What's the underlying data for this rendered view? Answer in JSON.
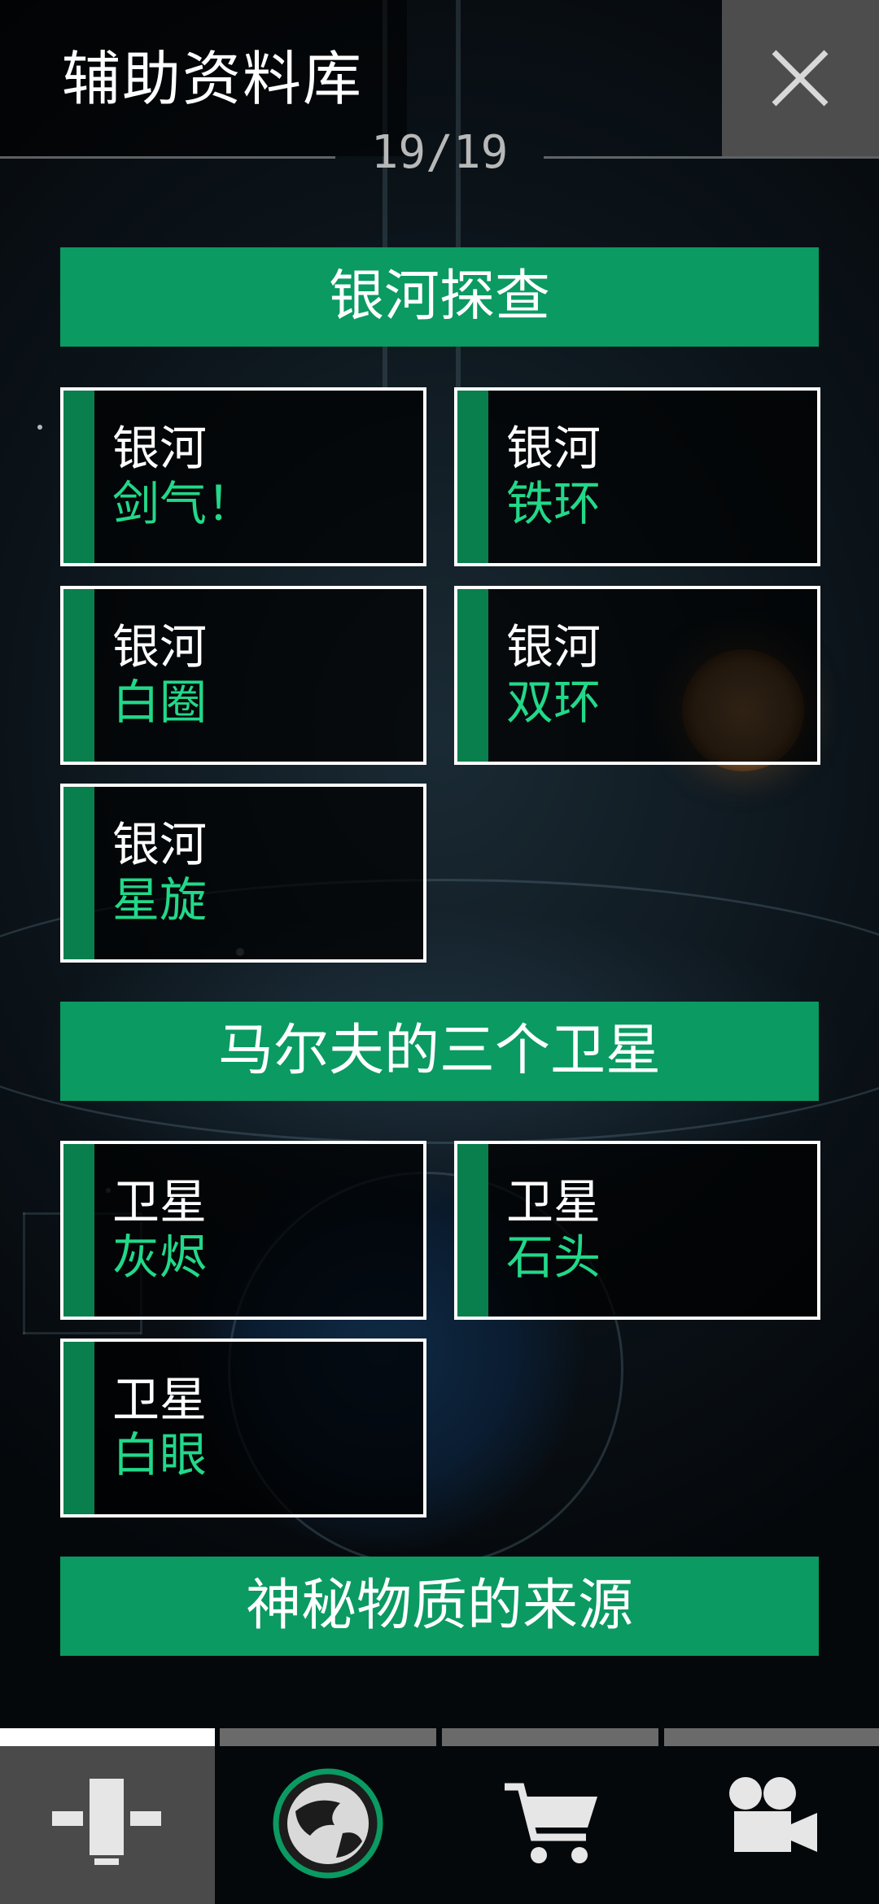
{
  "header": {
    "title": "辅助资料库",
    "counter": "19/19",
    "close_icon": "close-icon"
  },
  "sections": [
    {
      "title": "银河探查",
      "cards": [
        {
          "line1": "银河",
          "line2": "剑气！"
        },
        {
          "line1": "银河",
          "line2": "铁环"
        },
        {
          "line1": "银河",
          "line2": "白圈"
        },
        {
          "line1": "银河",
          "line2": "双环"
        },
        {
          "line1": "银河",
          "line2": "星旋"
        }
      ]
    },
    {
      "title": "马尔夫的三个卫星",
      "cards": [
        {
          "line1": "卫星",
          "line2": "灰烬"
        },
        {
          "line1": "卫星",
          "line2": "石头"
        },
        {
          "line1": "卫星",
          "line2": "白眼"
        }
      ]
    },
    {
      "title": "神秘物质的来源",
      "cards": []
    }
  ],
  "tabs": [
    {
      "icon": "database-icon",
      "active": true
    },
    {
      "icon": "globe-icon",
      "active": false
    },
    {
      "icon": "cart-icon",
      "active": false
    },
    {
      "icon": "video-camera-icon",
      "active": false
    }
  ],
  "colors": {
    "accent_green": "#0a9a62",
    "stripe_green": "#0a7f4e",
    "highlight_text": "#22d889",
    "close_bg": "#4d4d4d",
    "active_tab_bg": "#4a4a4a"
  }
}
